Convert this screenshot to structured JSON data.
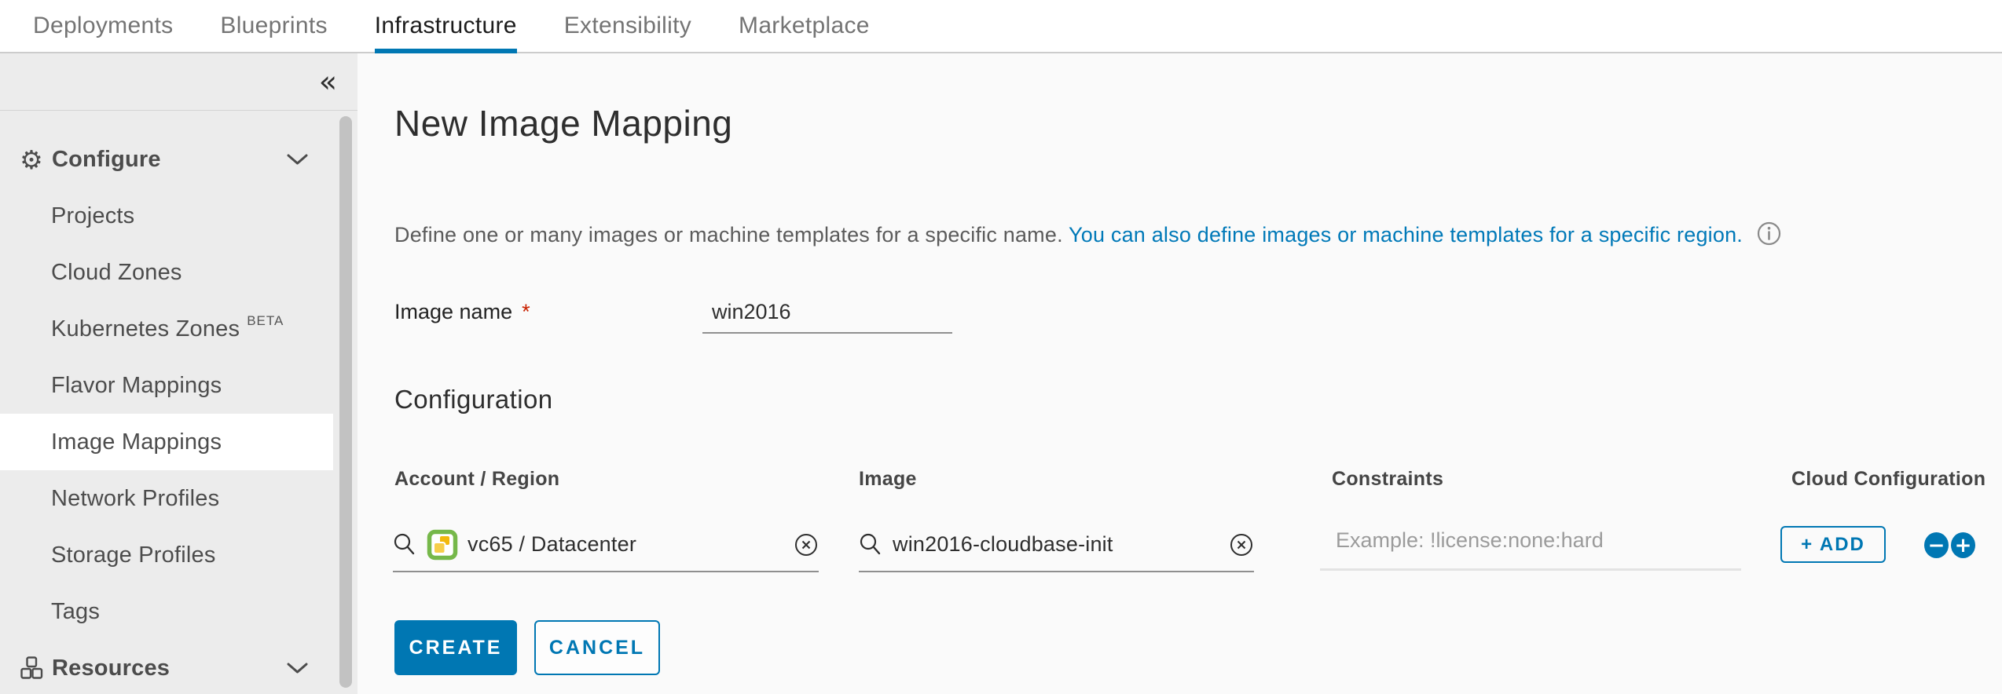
{
  "nav": {
    "tabs": [
      {
        "label": "Deployments",
        "active": false
      },
      {
        "label": "Blueprints",
        "active": false
      },
      {
        "label": "Infrastructure",
        "active": true
      },
      {
        "label": "Extensibility",
        "active": false
      },
      {
        "label": "Marketplace",
        "active": false
      }
    ]
  },
  "sidebar": {
    "collapse_glyph": "«",
    "gear_glyph": "⚙",
    "items": [
      {
        "label": "Configure",
        "type": "group",
        "icon": "gear-icon"
      },
      {
        "label": "Projects"
      },
      {
        "label": "Cloud Zones"
      },
      {
        "label": "Kubernetes Zones",
        "badge": "BETA"
      },
      {
        "label": "Flavor Mappings"
      },
      {
        "label": "Image Mappings",
        "selected": true
      },
      {
        "label": "Network Profiles"
      },
      {
        "label": "Storage Profiles"
      },
      {
        "label": "Tags"
      },
      {
        "label": "Resources",
        "type": "group",
        "icon": "cubes-icon"
      }
    ]
  },
  "main": {
    "title": "New Image Mapping",
    "description": {
      "text": "Define one or many images or machine templates for a specific name. ",
      "link": "You can also define images or machine templates for a specific region.",
      "info_icon": "info-icon"
    },
    "form": {
      "image_name_label": "Image name",
      "required_marker": "*",
      "image_name_value": "win2016"
    },
    "configuration": {
      "title": "Configuration",
      "columns": [
        "Account / Region",
        "Image",
        "Constraints",
        "Cloud Configuration"
      ],
      "row": {
        "account_region_value": "vc65 / Datacenter",
        "account_region_icon": "vsphere-icon",
        "image_value": "win2016-cloudbase-init",
        "constraints_placeholder": "Example: !license:none:hard",
        "add_button": "+ ADD",
        "minus_glyph": "−",
        "plus_glyph": "+"
      }
    },
    "actions": {
      "create": "CREATE",
      "cancel": "CANCEL"
    },
    "colors": {
      "accent": "#0077b3",
      "link": "#0079b8",
      "sidebar_bg": "#ececec",
      "selected_bg": "#ffffff",
      "required_red": "#c92100"
    }
  }
}
